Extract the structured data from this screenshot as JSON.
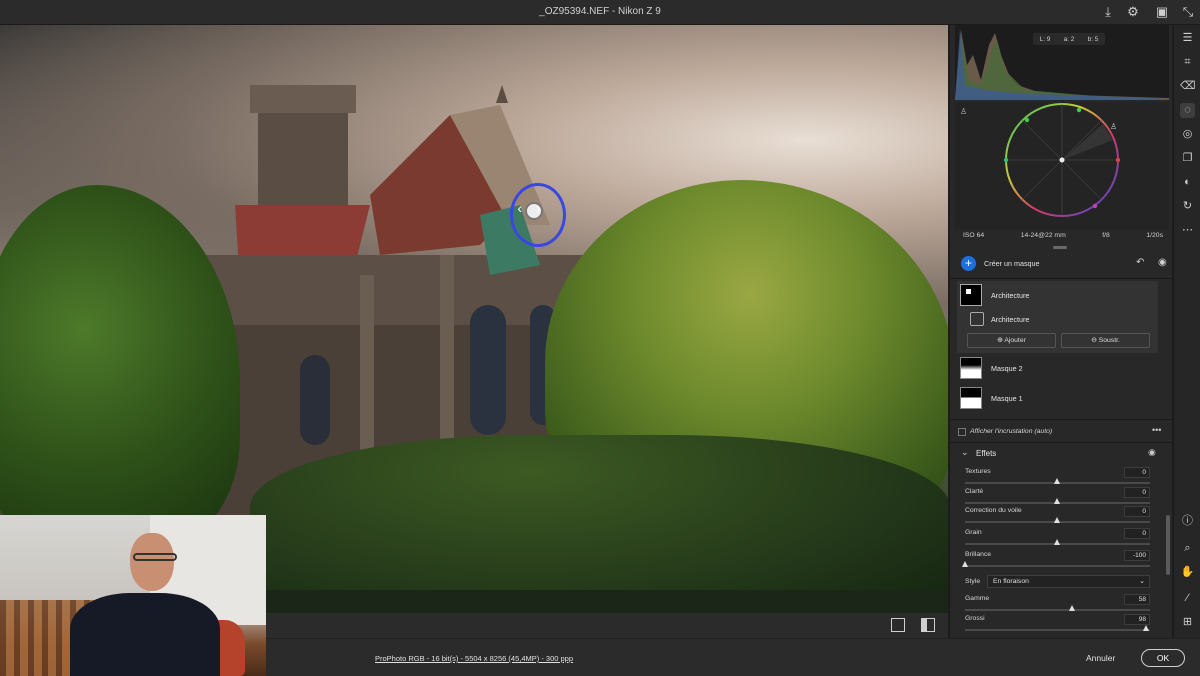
{
  "window": {
    "title": "_OZ95394.NEF  -  Nikon Z 9"
  },
  "histogram": {
    "lab_l": "L: 9",
    "lab_a": "a: 2",
    "lab_b": "b: 5"
  },
  "exif": {
    "iso": "ISO 64",
    "lens": "14-24@22 mm",
    "aperture": "f/8",
    "shutter": "1/20s"
  },
  "masks": {
    "create_label": "Créer un masque",
    "items": [
      {
        "label": "Architecture"
      },
      {
        "label": "Architecture"
      },
      {
        "label": "Masque 2"
      },
      {
        "label": "Masque 1"
      }
    ],
    "add_label": "Ajouter",
    "subtract_label": "Soustr.",
    "overlay_label": "Afficher l'incrustation (auto)"
  },
  "effects": {
    "title": "Effets",
    "sliders": [
      {
        "name": "Textures",
        "value": "0",
        "pos": 0.5
      },
      {
        "name": "Clarté",
        "value": "0",
        "pos": 0.5
      },
      {
        "name": "Correction du voile",
        "value": "0",
        "pos": 0.5
      },
      {
        "name": "Grain",
        "value": "0",
        "pos": 0.5
      },
      {
        "name": "Brillance",
        "value": "-100",
        "pos": 0.0
      },
      {
        "name": "Gamme",
        "value": "58",
        "pos": 0.58
      },
      {
        "name": "Grossi",
        "value": "98",
        "pos": 0.98
      }
    ],
    "style_label": "Style",
    "style_value": "En floraison"
  },
  "statusbar": {
    "file_info": "ProPhoto RGB - 16 bit(s) - 5504 x 8256 (45,4MP) - 300 ppp",
    "cancel": "Annuler",
    "ok": "OK"
  },
  "colors": {
    "accent": "#1d6fe0",
    "mask_brush": "#3a48e0"
  }
}
